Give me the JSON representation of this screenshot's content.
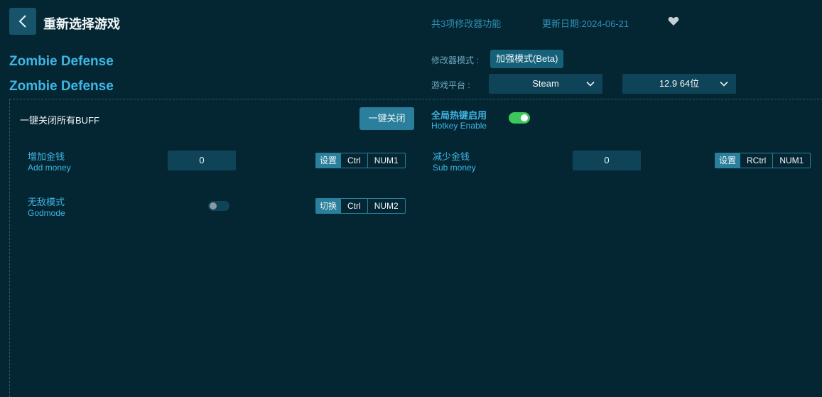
{
  "header": {
    "title": "重新选择游戏",
    "feature_count": "共3项修改器功能",
    "update_date": "更新日期:2024-06-21"
  },
  "game": {
    "name_line1": "Zombie Defense",
    "name_line2": "Zombie Defense"
  },
  "settings": {
    "mode_label": "修改器模式 :",
    "mode_value": "加强模式(Beta)",
    "platform_label": "游戏平台 :",
    "platform_value": "Steam",
    "version_value": "12.9 64位"
  },
  "panel": {
    "buff_label": "一键关闭所有BUFF",
    "close_all_label": "一键关闭",
    "hotkey_zh": "全局热键启用",
    "hotkey_en": "Hotkey Enable",
    "hotkey_enabled": true
  },
  "features": [
    {
      "name_zh": "增加金钱",
      "name_en": "Add money",
      "value": "0",
      "action": "设置",
      "keys": [
        "Ctrl",
        "NUM1"
      ]
    },
    {
      "name_zh": "减少金钱",
      "name_en": "Sub money",
      "value": "0",
      "action": "设置",
      "keys": [
        "RCtrl",
        "NUM1"
      ]
    },
    {
      "name_zh": "无敌模式",
      "name_en": "Godmode",
      "enabled": false,
      "action": "切换",
      "keys": [
        "Ctrl",
        "NUM2"
      ]
    }
  ],
  "colors": {
    "background": "#042633",
    "accent": "#3fb6e4",
    "button": "#2a7f9c",
    "toggle_on": "#3cc75a"
  }
}
